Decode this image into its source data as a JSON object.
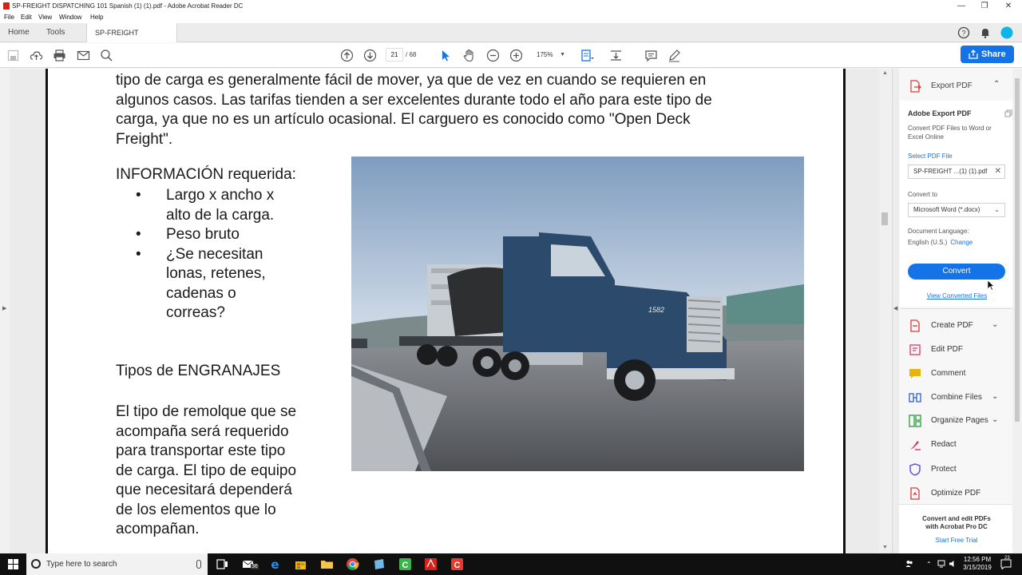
{
  "window": {
    "title": "SP-FREIGHT DISPATCHING 101 Spanish (1) (1).pdf - Adobe Acrobat Reader DC",
    "controls": [
      "—",
      "❐",
      "✕"
    ]
  },
  "menu": [
    "File",
    "Edit",
    "View",
    "Window",
    "Help"
  ],
  "tabs": {
    "home": "Home",
    "tools": "Tools",
    "document": "SP-FREIGHT DISPA...",
    "close": "×"
  },
  "toolbar": {
    "page_current": "21",
    "page_total": "/ 68",
    "zoom": "175%",
    "share_label": "Share"
  },
  "document": {
    "paragraph_lines": [
      "tipo de carga es generalmente fácil de mover, ya que de vez en cuando se requieren en",
      "algunos casos. Las tarifas tienden a ser excelentes durante todo el año para este tipo de",
      "carga, ya que no es un artículo ocasional. El carguero es conocido como \"Open Deck",
      "Freight\"."
    ],
    "info_title": "INFORMACIÓN requerida:",
    "bullets": [
      [
        "Largo x ancho x",
        "alto de la carga."
      ],
      [
        "Peso bruto"
      ],
      [
        "¿Se necesitan",
        "lonas, retenes,",
        "cadenas o",
        "correas?"
      ]
    ],
    "bullet_char": "•",
    "tipos_title": "Tipos de ENGRANAJES",
    "tipos_lines": [
      "El tipo de remolque que se",
      "acompaña será requerido",
      "para transportar este tipo",
      "de carga. El tipo de equipo",
      "que necesitará dependerá",
      "de los elementos que lo",
      "acompañan."
    ],
    "truck_number": "1582"
  },
  "right_panel": {
    "header": "Export PDF",
    "card_title": "Adobe Export PDF",
    "description": "Convert PDF Files to Word or Excel Online",
    "select_label": "Select PDF File",
    "file_name": "SP-FREIGHT ...(1) (1).pdf",
    "convert_to_label": "Convert to",
    "convert_to_value": "Microsoft Word (*.docx)",
    "language_label": "Document Language:",
    "language_value": "English (U.S.)",
    "change_label": "Change",
    "convert_button": "Convert",
    "view_converted": "View Converted Files",
    "tools": [
      {
        "label": "Create PDF",
        "icon": "create-pdf-icon",
        "color": "#d93b3b",
        "chevron": true
      },
      {
        "label": "Edit PDF",
        "icon": "edit-pdf-icon",
        "color": "#d93b6b",
        "chevron": false
      },
      {
        "label": "Comment",
        "icon": "comment-icon",
        "color": "#e7b30e",
        "chevron": false
      },
      {
        "label": "Combine Files",
        "icon": "combine-files-icon",
        "color": "#2d5fd0",
        "chevron": true
      },
      {
        "label": "Organize Pages",
        "icon": "organize-pages-icon",
        "color": "#2e9d3c",
        "chevron": true
      },
      {
        "label": "Redact",
        "icon": "redact-icon",
        "color": "#d93b6b",
        "chevron": false
      },
      {
        "label": "Protect",
        "icon": "protect-icon",
        "color": "#5b4bd6",
        "chevron": false
      },
      {
        "label": "Optimize PDF",
        "icon": "optimize-pdf-icon",
        "color": "#d93b3b",
        "chevron": false
      }
    ],
    "promo_line1": "Convert and edit PDFs",
    "promo_line2": "with Acrobat Pro DC",
    "trial": "Start Free Trial"
  },
  "taskbar": {
    "search_placeholder": "Type here to search",
    "mail_badge": "36",
    "time": "12:56 PM",
    "date": "3/15/2019",
    "notification_count": "23"
  },
  "colors": {
    "accent": "#1473e6",
    "acrobat_red": "#d4221c",
    "truck_blue": "#2c4a6b"
  }
}
